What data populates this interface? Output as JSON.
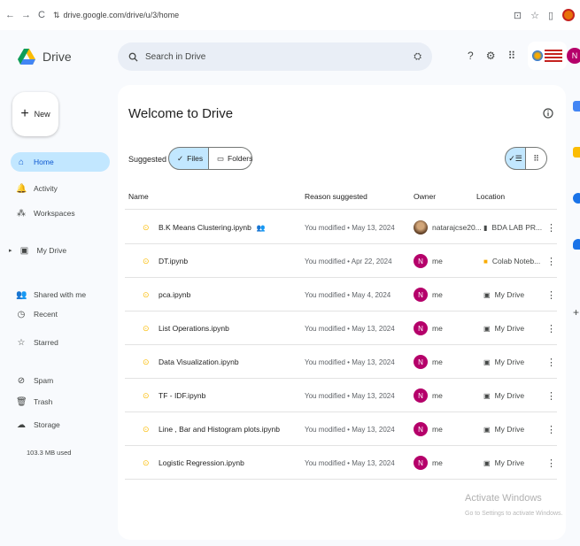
{
  "browser": {
    "back": "←",
    "forward": "→",
    "reload": "C",
    "tune": "⇅",
    "url": "drive.google.com/drive/u/3/home",
    "right_icons": [
      "⊡",
      "☆",
      "▯"
    ]
  },
  "header": {
    "app_name": "Drive",
    "search_placeholder": "Search in Drive",
    "search_icon": "search-icon",
    "filter_icon": "⛭",
    "help_icon": "?",
    "settings_icon": "⚙",
    "apps_icon": "⠿",
    "avatar_letter": "N"
  },
  "sidebar": {
    "new_label": "New",
    "new_plus": "+",
    "items": [
      {
        "label": "Home",
        "icon": "⌂",
        "icon_name": "home-icon",
        "active": true
      },
      {
        "label": "Activity",
        "icon": "🔔",
        "icon_name": "activity-icon",
        "active": false
      },
      {
        "label": "Workspaces",
        "icon": "⁂",
        "icon_name": "workspaces-icon",
        "active": false
      },
      {
        "label": "My Drive",
        "icon": "▣",
        "icon_name": "my-drive-icon",
        "active": false,
        "expand": "▸"
      },
      {
        "label": "Shared with me",
        "icon": "👥",
        "icon_name": "shared-icon",
        "active": false
      },
      {
        "label": "Recent",
        "icon": "◷",
        "icon_name": "recent-icon",
        "active": false
      },
      {
        "label": "Starred",
        "icon": "☆",
        "icon_name": "starred-icon",
        "active": false
      },
      {
        "label": "Spam",
        "icon": "⊘",
        "icon_name": "spam-icon",
        "active": false
      },
      {
        "label": "Trash",
        "icon": "🗑",
        "icon_name": "trash-icon",
        "active": false
      },
      {
        "label": "Storage",
        "icon": "☁",
        "icon_name": "storage-icon",
        "active": false
      }
    ],
    "storage_used": "103.3 MB used"
  },
  "main": {
    "title": "Welcome to Drive",
    "suggested_label": "Suggested",
    "chip_files": "Files",
    "chip_files_check": "✓",
    "chip_folders": "Folders",
    "chip_folders_icon": "▭",
    "columns": {
      "name": "Name",
      "reason": "Reason suggested",
      "owner": "Owner",
      "location": "Location"
    },
    "rows": [
      {
        "name": "B.K Means Clustering.ipynb",
        "shared": true,
        "reason": "You modified • May 13, 2024",
        "owner": "natarajcse20...",
        "owner_photo": true,
        "location": "BDA LAB PR...",
        "loc_type": "shared-drive"
      },
      {
        "name": "DT.ipynb",
        "shared": false,
        "reason": "You modified • Apr 22, 2024",
        "owner": "me",
        "owner_photo": false,
        "location": "Colab Noteb...",
        "loc_type": "folder"
      },
      {
        "name": "pca.ipynb",
        "shared": false,
        "reason": "You modified • May 4, 2024",
        "owner": "me",
        "owner_photo": false,
        "location": "My Drive",
        "loc_type": "drive"
      },
      {
        "name": "List Operations.ipynb",
        "shared": false,
        "reason": "You modified • May 13, 2024",
        "owner": "me",
        "owner_photo": false,
        "location": "My Drive",
        "loc_type": "drive"
      },
      {
        "name": "Data Visualization.ipynb",
        "shared": false,
        "reason": "You modified • May 13, 2024",
        "owner": "me",
        "owner_photo": false,
        "location": "My Drive",
        "loc_type": "drive"
      },
      {
        "name": "TF - IDF.ipynb",
        "shared": false,
        "reason": "You modified • May 13, 2024",
        "owner": "me",
        "owner_photo": false,
        "location": "My Drive",
        "loc_type": "drive"
      },
      {
        "name": "Line , Bar and Histogram plots.ipynb",
        "shared": false,
        "reason": "You modified • May 13, 2024",
        "owner": "me",
        "owner_photo": false,
        "location": "My Drive",
        "loc_type": "drive"
      },
      {
        "name": "Logistic Regression.ipynb",
        "shared": false,
        "reason": "You modified • May 13, 2024",
        "owner": "me",
        "owner_photo": false,
        "location": "My Drive",
        "loc_type": "drive"
      }
    ],
    "owner_letter": "N",
    "more_icon": "⋮",
    "file_icon": "⊙"
  },
  "watermark": {
    "line1": "Activate Windows",
    "line2": "Go to Settings to activate Windows."
  },
  "colors": {
    "accent": "#0b57d0",
    "active_bg": "#c2e7ff",
    "avatar": "#b5006a",
    "file_icon": "#fbbc04"
  }
}
